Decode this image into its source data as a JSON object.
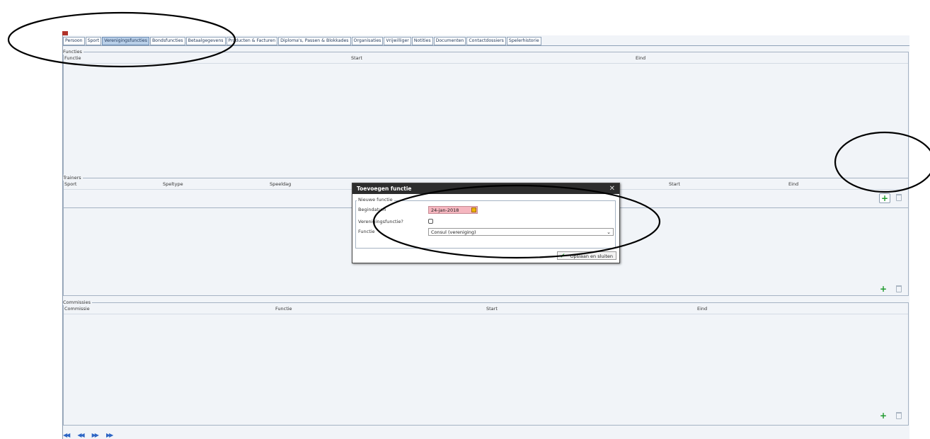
{
  "tabs": [
    {
      "label": "Persoon",
      "active": false
    },
    {
      "label": "Sport",
      "active": false
    },
    {
      "label": "Verenigingsfuncties",
      "active": true
    },
    {
      "label": "Bondsfuncties",
      "active": false
    },
    {
      "label": "Betaalgegevens",
      "active": false
    },
    {
      "label": "Producten & Facturen",
      "active": false
    },
    {
      "label": "Diploma's, Passen & Blokkades",
      "active": false
    },
    {
      "label": "Organisaties",
      "active": false
    },
    {
      "label": "Vrijwilliger",
      "active": false
    },
    {
      "label": "Notities",
      "active": false
    },
    {
      "label": "Documenten",
      "active": false
    },
    {
      "label": "Contactdossiers",
      "active": false
    },
    {
      "label": "Spelerhistorie",
      "active": false
    }
  ],
  "functies": {
    "legend": "Functies",
    "columns": [
      "Functie",
      "Start",
      "Eind"
    ]
  },
  "trainers": {
    "legend": "Trainers",
    "columns": [
      "Sport",
      "Speltype",
      "Speeldag",
      "Start",
      "Eind"
    ]
  },
  "commissies": {
    "legend": "Commissies",
    "columns": [
      "Commissie",
      "Functie",
      "Start",
      "Eind"
    ]
  },
  "icons": {
    "add": "plus-icon",
    "delete": "trash-icon",
    "nav": [
      "first-record-icon",
      "previous-record-icon",
      "next-record-icon",
      "last-record-icon"
    ],
    "nav_glyphs": [
      "◀◀",
      "◀◀",
      "▶▶",
      "▶▶"
    ]
  },
  "colors": {
    "tab_active": "#b9cfe8",
    "panel_bg": "#f1f4f8",
    "dialog_title_bg": "#2d2d2d",
    "date_invalid_bg": "#f5b6bf",
    "add_green": "#1f9a2e",
    "annotation": "#000000"
  },
  "dialog": {
    "title": "Toevoegen functie",
    "close_glyph": "✕",
    "group_legend": "Nieuwe functie",
    "begindatum_label": "Begindatum",
    "begindatum_value": "24-jan-2018",
    "verenigingsfunctie_label": "Verenigingsfunctie?",
    "verenigingsfunctie_checked": false,
    "functie_label": "Functie",
    "functie_value": "Consul (vereniging)",
    "save_label": "Opslaan en sluiten"
  }
}
